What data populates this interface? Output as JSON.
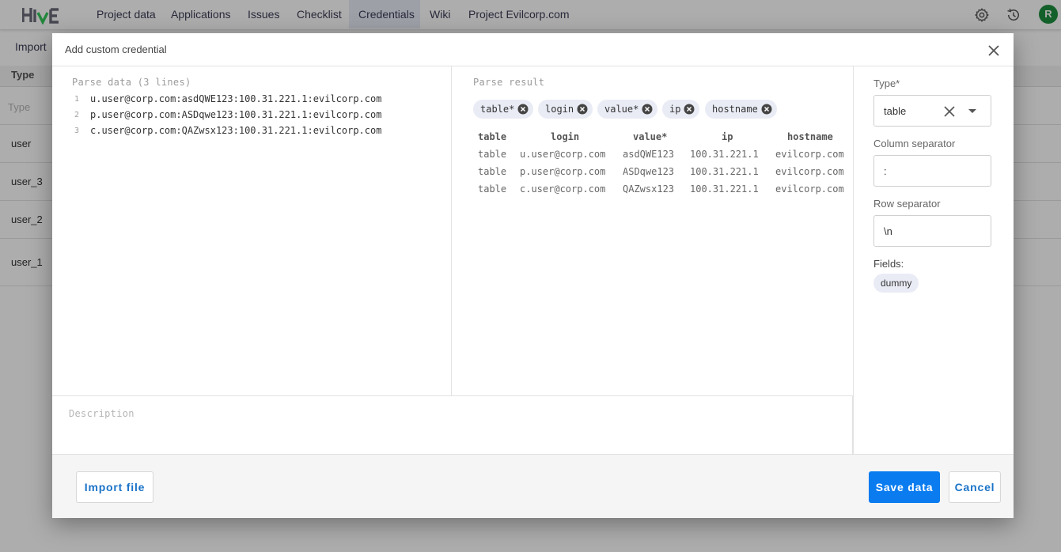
{
  "nav": {
    "logo": "HIVE",
    "items": [
      "Project data",
      "Applications",
      "Issues",
      "Checklist",
      "Credentials",
      "Wiki",
      "Project Evilcorp.com"
    ],
    "active": "Credentials",
    "avatar_letter": "R"
  },
  "background": {
    "import_label": "Import",
    "column_header": "Type",
    "filter_placeholder": "Type",
    "rows": [
      "user",
      "user_3",
      "user_2",
      "user_1"
    ]
  },
  "dialog": {
    "title": "Add custom credential",
    "parse_data_label": "Parse data (3 lines)",
    "lines": [
      "u.user@corp.com:asdQWE123:100.31.221.1:evilcorp.com",
      "p.user@corp.com:ASDqwe123:100.31.221.1:evilcorp.com",
      "c.user@corp.com:QAZwsx123:100.31.221.1:evilcorp.com"
    ],
    "parse_result_label": "Parse result",
    "chips": [
      "table*",
      "login",
      "value*",
      "ip",
      "hostname"
    ],
    "result_headers": [
      "table",
      "login",
      "value*",
      "ip",
      "hostname"
    ],
    "result_rows": [
      [
        "table",
        "u.user@corp.com",
        "asdQWE123",
        "100.31.221.1",
        "evilcorp.com"
      ],
      [
        "table",
        "p.user@corp.com",
        "ASDqwe123",
        "100.31.221.1",
        "evilcorp.com"
      ],
      [
        "table",
        "c.user@corp.com",
        "QAZwsx123",
        "100.31.221.1",
        "evilcorp.com"
      ]
    ],
    "description_placeholder": "Description",
    "type_label": "Type*",
    "type_value": "table",
    "column_separator_label": "Column separator",
    "column_separator_value": ":",
    "row_separator_label": "Row separator",
    "row_separator_value": "\\n",
    "fields_label": "Fields:",
    "fields": [
      "dummy"
    ],
    "import_file_label": "Import file",
    "save_label": "Save data",
    "cancel_label": "Cancel"
  },
  "colors": {
    "accent": "#0a7cf0",
    "nav_active": "#e9ecf8",
    "chip_bg": "#e9ecf5",
    "avatar": "#1e8e3e",
    "logo_green": "#34c759"
  }
}
